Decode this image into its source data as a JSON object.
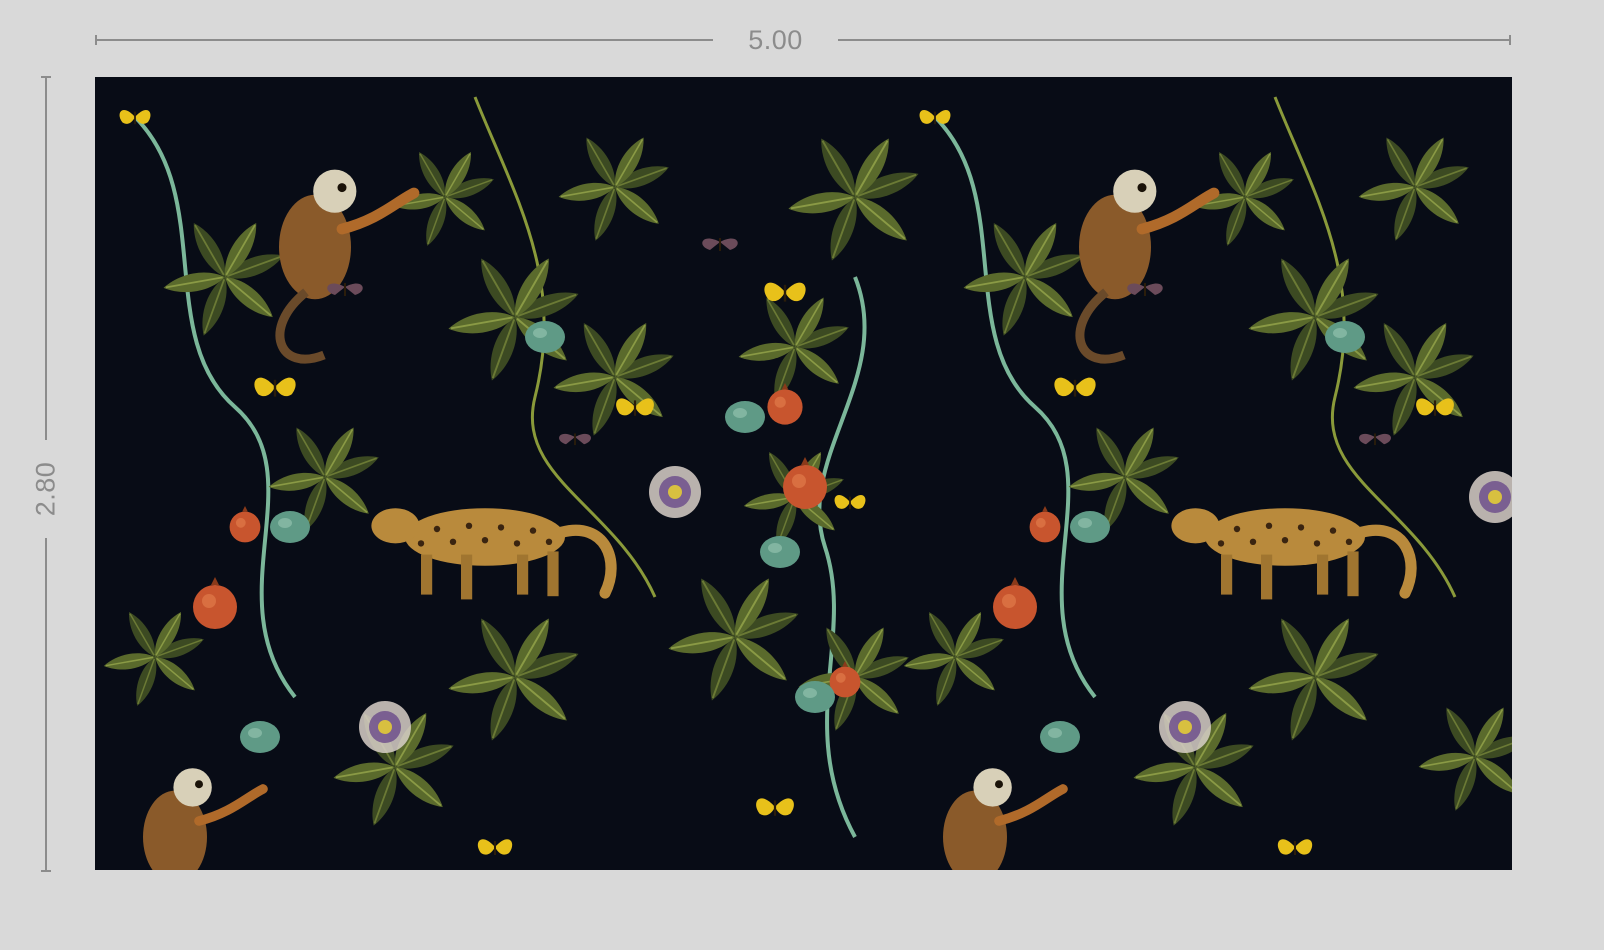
{
  "dimensions": {
    "width_label": "5.00",
    "height_label": "2.80"
  },
  "preview": {
    "background_color": "#080c16",
    "motifs": [
      "monkey",
      "ocelot",
      "passion-flower",
      "butterfly",
      "moth",
      "pomegranate",
      "leaves",
      "vines"
    ]
  },
  "colors": {
    "page_background": "#d9d9d9",
    "dimension_line": "#8c8c8c",
    "leaf_dark": "#3c4a22",
    "leaf_light": "#6b7a35",
    "fruit_red": "#c8552e",
    "fruit_teal": "#5f9a86",
    "butterfly_yellow": "#e8c11a",
    "ocelot": "#b98a3c",
    "monkey": "#8a5a2a"
  }
}
